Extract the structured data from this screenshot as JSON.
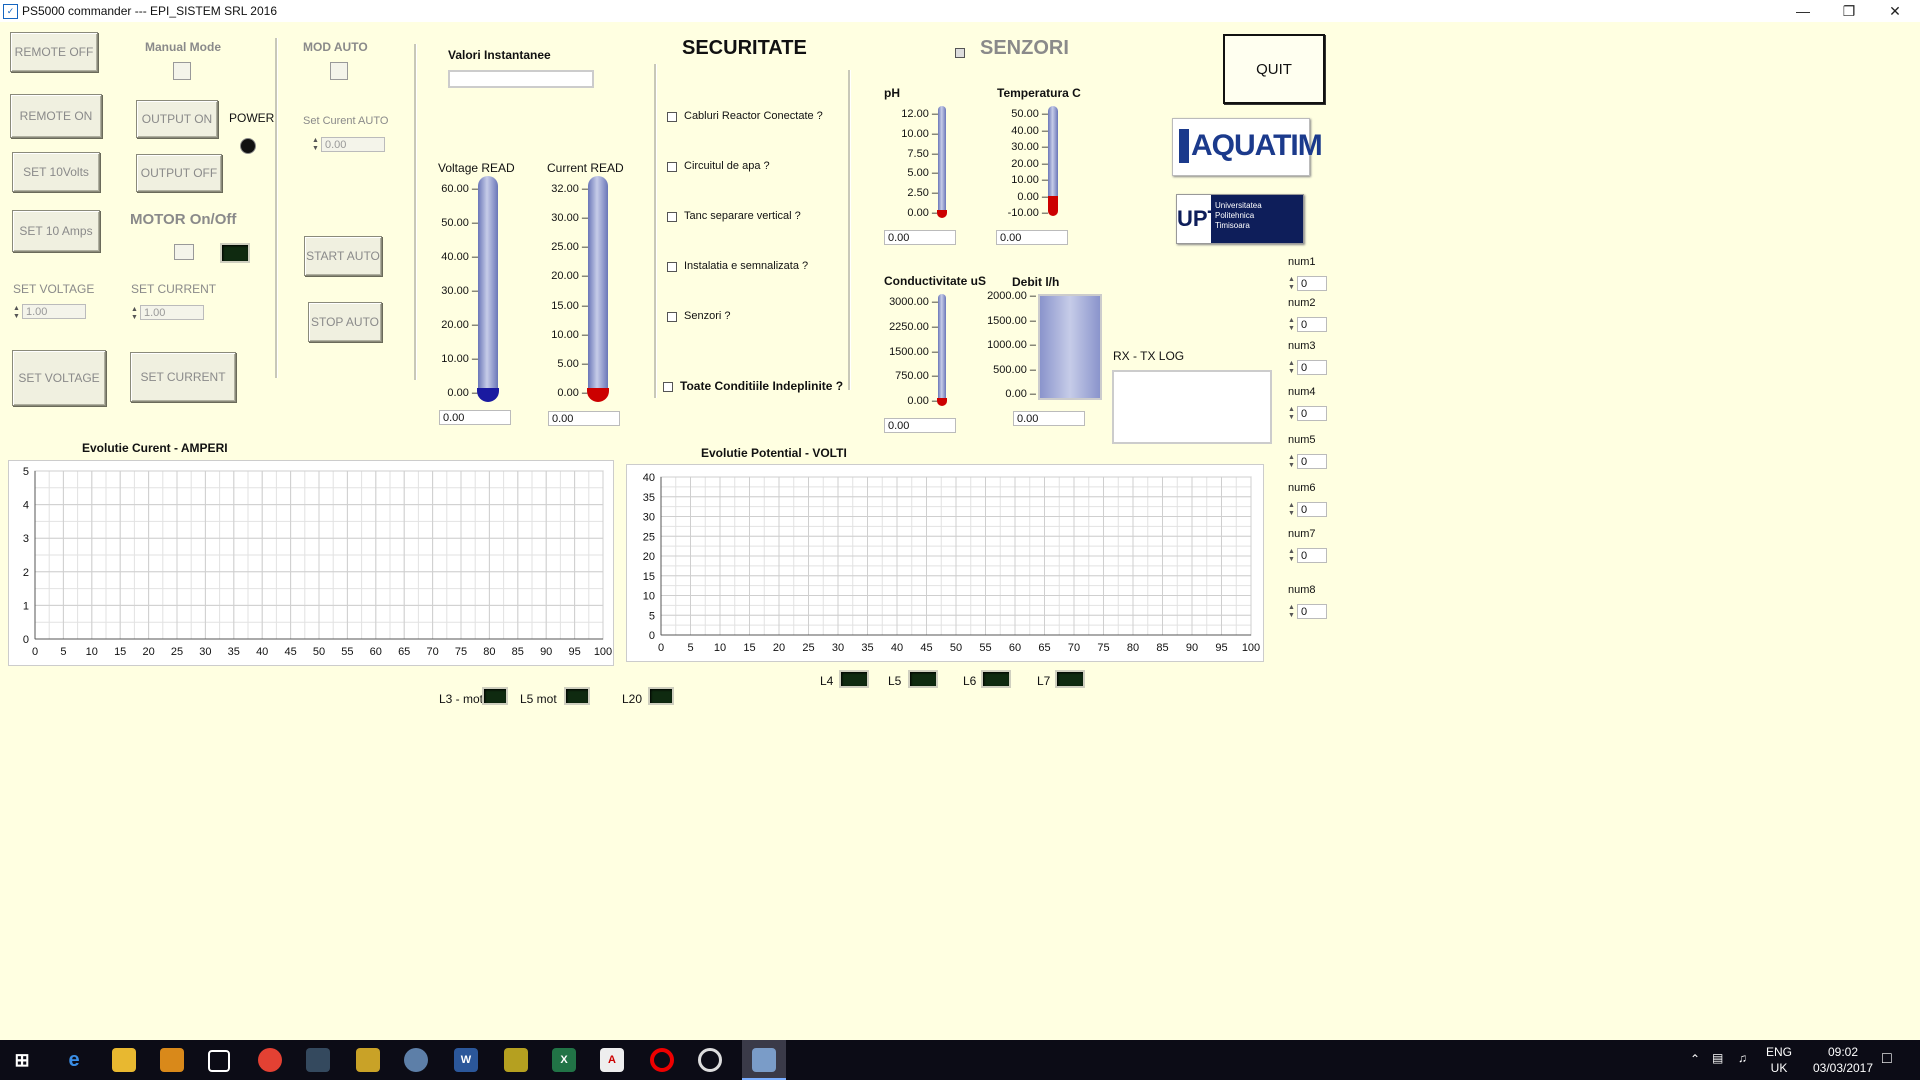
{
  "window": {
    "title": "PS5000 commander --- EPI_SISTEM SRL 2016"
  },
  "left": {
    "remote_off": "REMOTE OFF",
    "remote_on": "REMOTE ON",
    "set_10volts": "SET 10Volts",
    "set_10amps": "SET 10 Amps",
    "manual_mode": "Manual Mode",
    "output_on": "OUTPUT ON",
    "output_off": "OUTPUT OFF",
    "power": "POWER",
    "motor": "MOTOR On/Off",
    "set_voltage_label": "SET VOLTAGE",
    "set_current_label": "SET CURRENT",
    "set_voltage_value": "1.00",
    "set_current_value": "1.00",
    "set_voltage_btn": "SET VOLTAGE",
    "set_current_btn": "SET CURRENT"
  },
  "auto": {
    "mod_auto": "MOD AUTO",
    "set_current_auto": "Set Curent AUTO",
    "set_current_auto_value": "0.00",
    "start": "START AUTO",
    "stop": "STOP AUTO"
  },
  "instant": {
    "title": "Valori Instantanee",
    "voltage_label": "Voltage READ",
    "current_label": "Current READ",
    "voltage_ticks": [
      "60.00",
      "50.00",
      "40.00",
      "30.00",
      "20.00",
      "10.00",
      "0.00"
    ],
    "current_ticks": [
      "32.00",
      "30.00",
      "25.00",
      "20.00",
      "15.00",
      "10.00",
      "5.00",
      "0.00"
    ],
    "voltage_value": "0.00",
    "current_value": "0.00"
  },
  "security": {
    "title": "SECURITATE",
    "items": [
      "Cabluri Reactor Conectate ?",
      "Circuitul de apa ?",
      "Tanc separare vertical ?",
      "Instalatia e semnalizata ?",
      "Senzori ?"
    ],
    "all": "Toate Conditiile Indeplinite ?"
  },
  "sensors": {
    "title": "SENZORI",
    "ph_label": "pH",
    "ph_ticks": [
      "12.00",
      "10.00",
      "7.50",
      "5.00",
      "2.50",
      "0.00"
    ],
    "ph_value": "0.00",
    "temp_label": "Temperatura C",
    "temp_ticks": [
      "50.00",
      "40.00",
      "30.00",
      "20.00",
      "10.00",
      "0.00",
      "-10.00"
    ],
    "temp_value": "0.00",
    "cond_label": "Conductivitate uS",
    "cond_ticks": [
      "3000.00",
      "2250.00",
      "1500.00",
      "750.00",
      "0.00"
    ],
    "cond_value": "0.00",
    "debit_label": "Debit l/h",
    "debit_ticks": [
      "2000.00",
      "1500.00",
      "1000.00",
      "500.00",
      "0.00"
    ],
    "debit_value": "0.00"
  },
  "right": {
    "quit": "QUIT",
    "aquatim": "AQUATIM",
    "upt_lines": [
      "Universitatea",
      "Politehnica",
      "Timisoara"
    ],
    "upt": "UPT",
    "rxtx": "RX - TX LOG",
    "nums": [
      {
        "label": "num1",
        "value": "0"
      },
      {
        "label": "num2",
        "value": "0"
      },
      {
        "label": "num3",
        "value": "0"
      },
      {
        "label": "num4",
        "value": "0"
      },
      {
        "label": "num5",
        "value": "0"
      },
      {
        "label": "num6",
        "value": "0"
      },
      {
        "label": "num7",
        "value": "0"
      },
      {
        "label": "num8",
        "value": "0"
      }
    ]
  },
  "leds": {
    "l3": "L3 - mot",
    "l5mot": "L5 mot",
    "l20": "L20",
    "l4": "L4",
    "l5": "L5",
    "l6": "L6",
    "l7": "L7"
  },
  "chart_data": [
    {
      "type": "line",
      "title": "Evolutie Curent - AMPERI",
      "x": [],
      "y": [],
      "xlim": [
        0,
        100
      ],
      "ylim": [
        0,
        5
      ],
      "xticks": [
        0,
        5,
        10,
        15,
        20,
        25,
        30,
        35,
        40,
        45,
        50,
        55,
        60,
        65,
        70,
        75,
        80,
        85,
        90,
        95,
        100
      ],
      "yticks": [
        0,
        1,
        2,
        3,
        4,
        5
      ],
      "grid": true
    },
    {
      "type": "line",
      "title": "Evolutie Potential - VOLTI",
      "x": [],
      "y": [],
      "xlim": [
        0,
        100
      ],
      "ylim": [
        0,
        40
      ],
      "xticks": [
        0,
        5,
        10,
        15,
        20,
        25,
        30,
        35,
        40,
        45,
        50,
        55,
        60,
        65,
        70,
        75,
        80,
        85,
        90,
        95,
        100
      ],
      "yticks": [
        0,
        5,
        10,
        15,
        20,
        25,
        30,
        35,
        40
      ],
      "grid": true
    }
  ],
  "taskbar": {
    "lang": "ENG",
    "locale": "UK",
    "time": "09:02",
    "date": "03/03/2017"
  },
  "colors": {
    "background": "#ffffe1",
    "led_off": "#0f2a10",
    "gauge": "#8a94cc",
    "bulb_blue": "#1a1aa0",
    "bulb_red": "#cc0000"
  }
}
